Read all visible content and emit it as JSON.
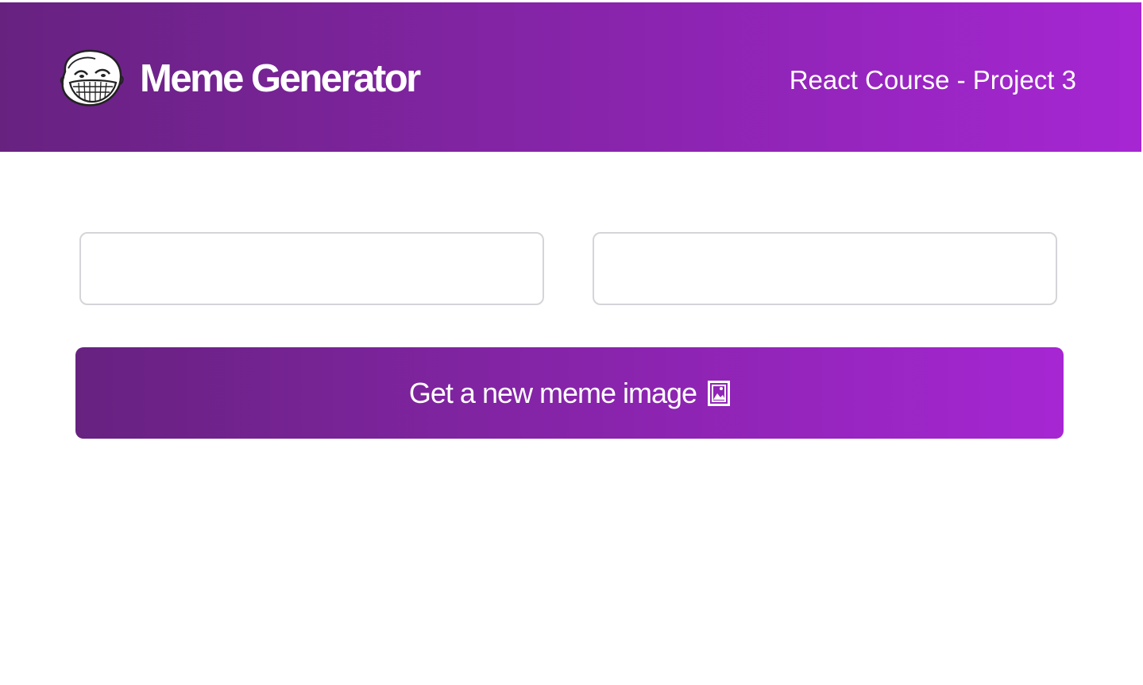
{
  "header": {
    "title": "Meme Generator",
    "subtitle": "React Course - Project 3",
    "logo_icon": "troll-face-icon",
    "gradient_start": "#672280",
    "gradient_end": "#A626D3"
  },
  "form": {
    "top_text": {
      "value": "",
      "placeholder": ""
    },
    "bottom_text": {
      "value": "",
      "placeholder": ""
    },
    "button": {
      "label": "Get a new meme image",
      "icon": "framed-picture-icon"
    }
  }
}
